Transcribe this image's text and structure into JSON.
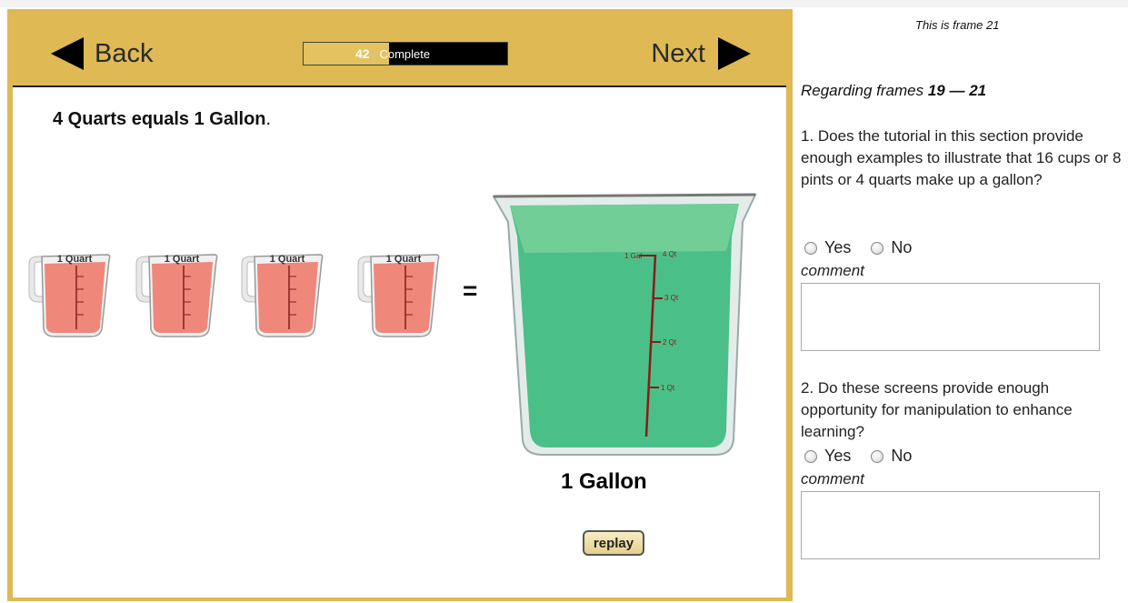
{
  "nav": {
    "back_label": "Back",
    "next_label": "Next",
    "progress": {
      "percent": 42,
      "percent_text": "42",
      "percent_sign": "%",
      "suffix": "Complete"
    }
  },
  "content": {
    "headline_bold": "4 Quarts equals 1 Gallon",
    "headline_tail": ".",
    "cup_label": "1 Quart",
    "cup_count": 4,
    "equals_sign": "=",
    "bucket_labels": [
      "1 Gal",
      "4 Qt",
      "3 Qt",
      "2 Qt",
      "1 Qt"
    ],
    "gallon_label": "1 Gallon",
    "replay_label": "replay",
    "colors": {
      "cup_liquid": "#ee7b6d",
      "bucket_liquid": "#2fb877",
      "frame": "#deb954",
      "measure_line": "#8b1a1a"
    }
  },
  "survey": {
    "frame_note": "This is frame 21",
    "regarding_prefix": "Regarding frames ",
    "regarding_range": "19 — 21",
    "questions": [
      {
        "text": "1. Does the tutorial in this section provide enough examples to illustrate that 16 cups or 8 pints or 4 quarts make up a gallon?",
        "yes": "Yes",
        "no": "No",
        "comment_label": "comment"
      },
      {
        "text": "2. Do these screens provide enough opportunity for manipulation to enhance learning?",
        "yes": "Yes",
        "no": "No",
        "comment_label": "comment"
      }
    ]
  }
}
